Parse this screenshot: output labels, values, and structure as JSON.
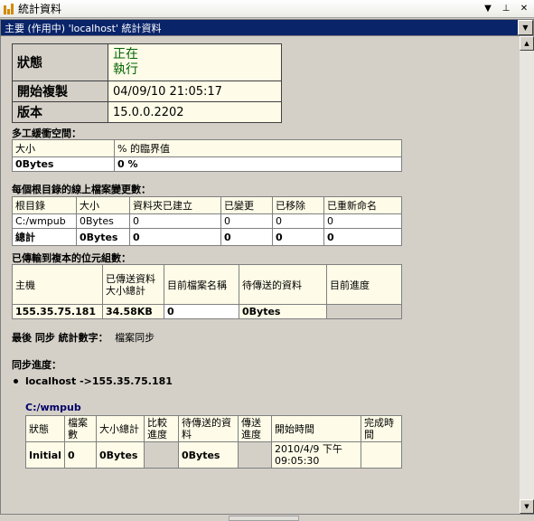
{
  "window": {
    "title": "統計資料",
    "menu_icon": "chevron-down-icon",
    "pin_icon": "pin-icon",
    "close_icon": "close-icon"
  },
  "selector": {
    "value": "主要 (作用中) 'localhost' 統計資料"
  },
  "status": {
    "state_label": "狀態",
    "state_value": "正在\n執行",
    "start_label": "開始複製",
    "start_value": "04/09/10 21:05:17",
    "version_label": "版本",
    "version_value": "15.0.0.2202"
  },
  "staging": {
    "title": "多工緩衝空間：",
    "headers": [
      "大小",
      "% 的臨界值"
    ],
    "row": [
      "0Bytes",
      "0 %"
    ]
  },
  "changes": {
    "title": "每個根目錄的線上檔案變更數：",
    "headers": [
      "根目錄",
      "大小",
      "資料夾已建立",
      "已變更",
      "已移除",
      "已重新命名"
    ],
    "rows": [
      [
        "C:/wmpub",
        "0Bytes",
        "0",
        "0",
        "0",
        "0"
      ]
    ],
    "total": [
      "總計",
      "0Bytes",
      "0",
      "0",
      "0",
      "0"
    ]
  },
  "bytes": {
    "title": "已傳輸到複本的位元組數：",
    "headers": [
      "主機",
      "已傳送資料大小總計",
      "目前檔案名稱",
      "待傳送的資料",
      "目前進度"
    ],
    "row": [
      "155.35.75.181",
      "34.58KB",
      "0",
      "0Bytes",
      ""
    ]
  },
  "last_sync": {
    "label": "最後 同步 統計數字：",
    "value": "檔案同步"
  },
  "sync_progress": {
    "title": "同步進度：",
    "host": "localhost ->155.35.75.181",
    "folder": "C:/wmpub",
    "headers": [
      "狀態",
      "檔案數",
      "大小總計",
      "比較進度",
      "待傳送的資料",
      "傳送進度",
      "開始時間",
      "完成時間"
    ],
    "row": [
      "Initial",
      "0",
      "0Bytes",
      "",
      "0Bytes",
      "",
      "2010/4/9 下午 09:05:30",
      ""
    ]
  }
}
